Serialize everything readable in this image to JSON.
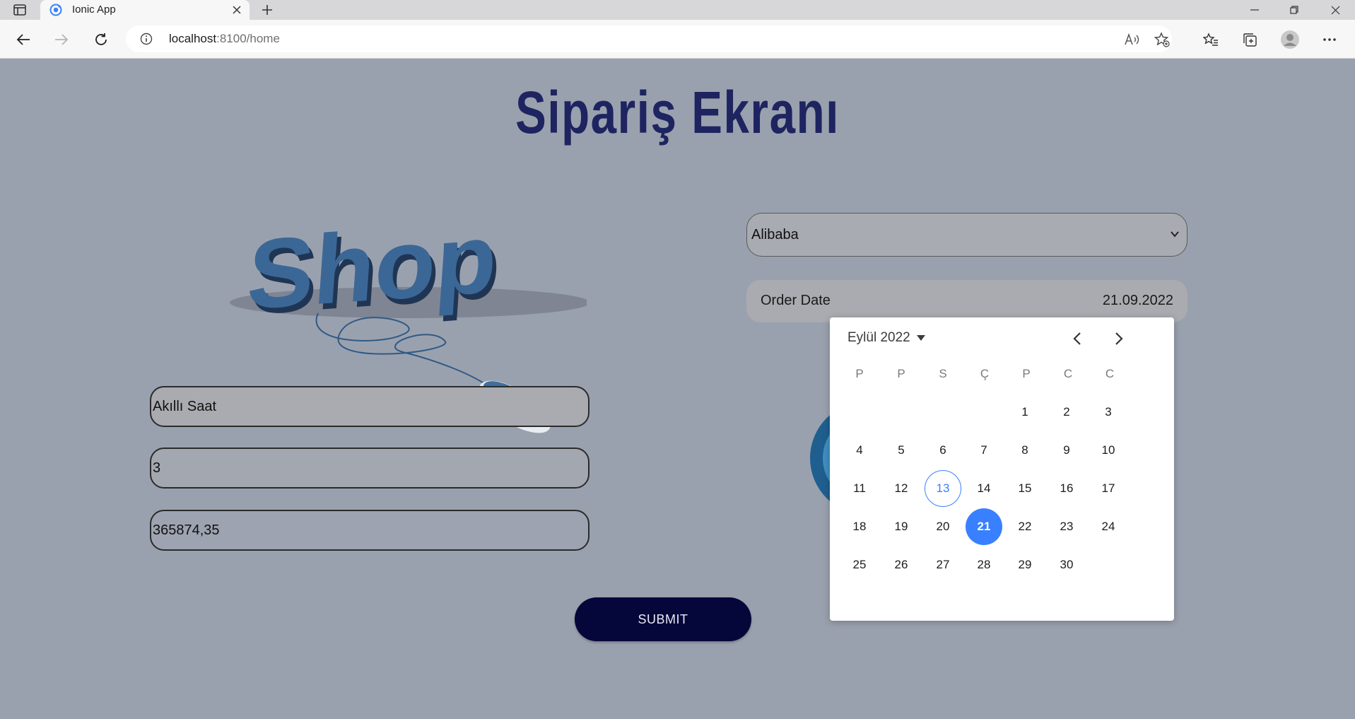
{
  "browser": {
    "tab_title": "Ionic App",
    "url_host": "localhost",
    "url_rest": ":8100/home"
  },
  "page": {
    "title": "Sipariş Ekranı",
    "product_field": "Akıllı Saat",
    "quantity_field": "3",
    "price_field": "365874,35",
    "submit_label": "SUBMIT",
    "supplier_select": "Alibaba",
    "order_date_label": "Order Date",
    "order_date_value": "21.09.2022",
    "shop_logo_text": "Shop"
  },
  "calendar": {
    "month_label": "Eylül 2022",
    "weekdays": [
      "P",
      "P",
      "S",
      "Ç",
      "P",
      "C",
      "C"
    ],
    "days": [
      "1",
      "2",
      "3",
      "4",
      "5",
      "6",
      "7",
      "8",
      "9",
      "10",
      "11",
      "12",
      "13",
      "14",
      "15",
      "16",
      "17",
      "18",
      "19",
      "20",
      "21",
      "22",
      "23",
      "24",
      "25",
      "26",
      "27",
      "28",
      "29",
      "30"
    ],
    "today": "13",
    "selected": "21",
    "accent_color": "#3880ff"
  },
  "colors": {
    "page_bg": "#9aa1ae",
    "title": "#1e2460",
    "submit_bg": "#05063a"
  }
}
